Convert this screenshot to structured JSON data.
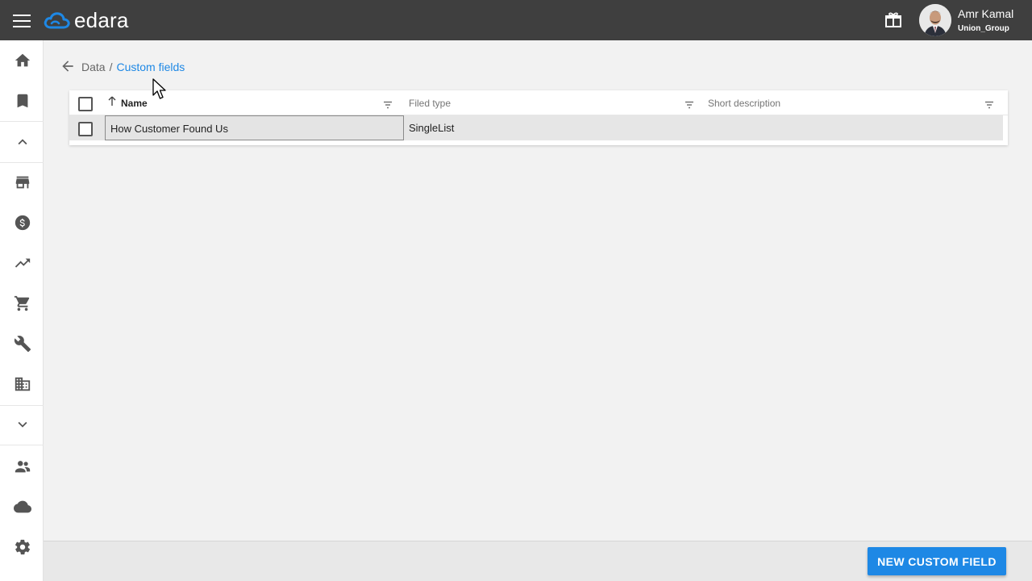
{
  "app": {
    "name": "edara",
    "brand_color": "#1e88e5",
    "topbar_color": "#3f3f3f"
  },
  "header": {
    "menu_icon": "hamburger-menu-icon",
    "gift_icon": "gift-icon",
    "user": {
      "name": "Amr Kamal",
      "organization": "Union_Group"
    }
  },
  "sidebar": {
    "items": [
      {
        "icon": "home-icon"
      },
      {
        "icon": "bookmark-icon"
      },
      {
        "icon": "chevron-up-icon"
      },
      {
        "icon": "store-icon"
      },
      {
        "icon": "dollar-icon"
      },
      {
        "icon": "trending-up-icon"
      },
      {
        "icon": "cart-icon"
      },
      {
        "icon": "wrench-icon"
      },
      {
        "icon": "building-icon"
      },
      {
        "icon": "chevron-down-icon"
      },
      {
        "icon": "people-icon"
      },
      {
        "icon": "cloud-icon"
      },
      {
        "icon": "settings-gear-icon"
      }
    ]
  },
  "breadcrumb": {
    "parent": "Data",
    "separator": "/",
    "current": "Custom fields"
  },
  "table": {
    "columns": [
      {
        "label": "Name",
        "sorted": "ascending"
      },
      {
        "label": "Filed type"
      },
      {
        "label": "Short description"
      }
    ],
    "rows": [
      {
        "name": "How Customer Found Us",
        "type": "SingleList",
        "description": ""
      }
    ]
  },
  "footer": {
    "new_button_label": "NEW CUSTOM FIELD"
  }
}
